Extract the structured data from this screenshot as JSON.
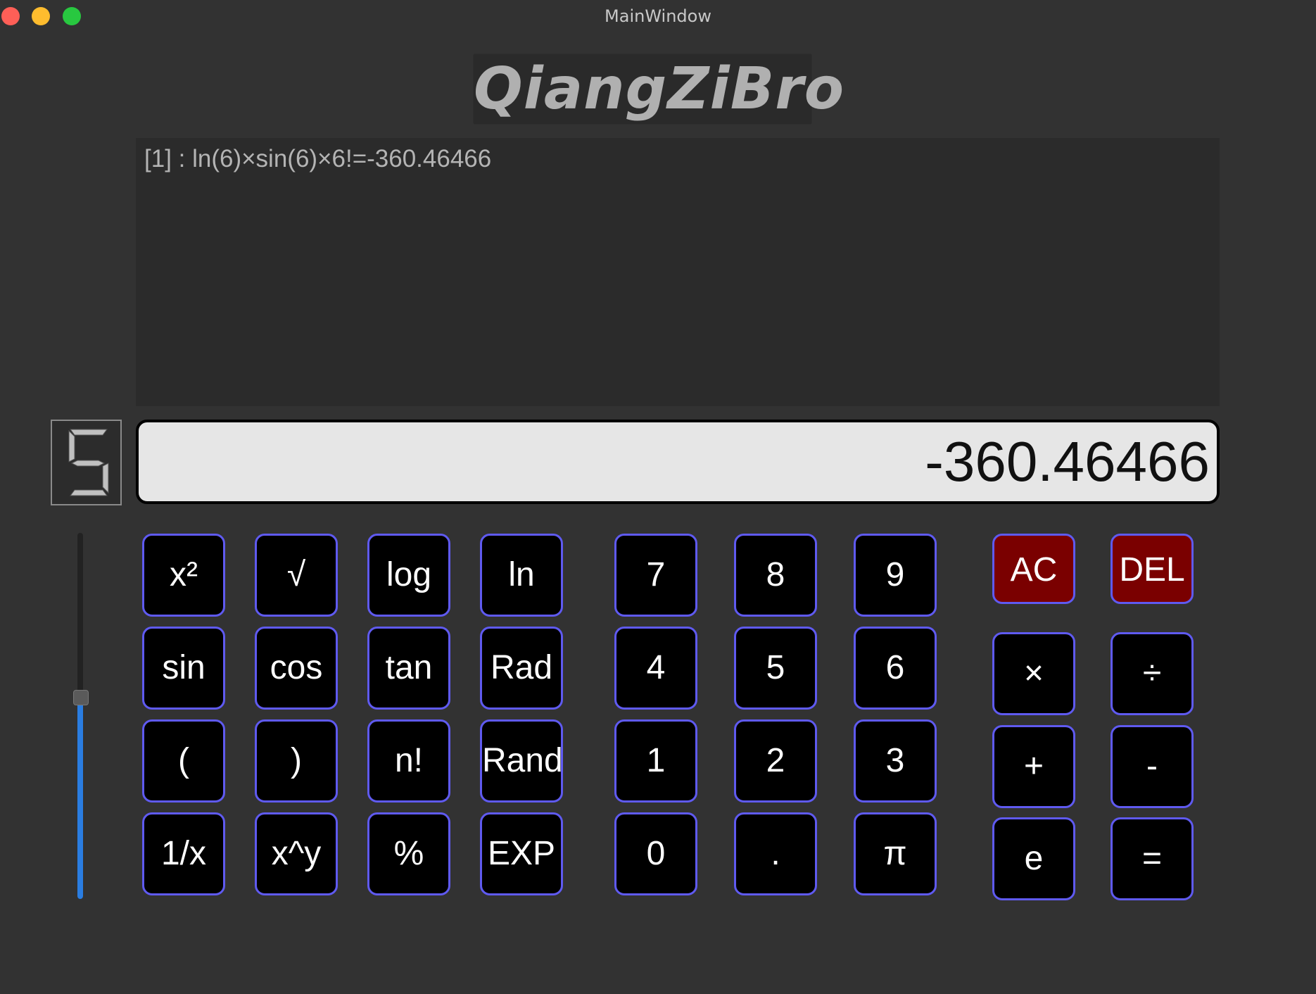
{
  "window": {
    "title": "MainWindow"
  },
  "brand": {
    "text": "QiangZiBro"
  },
  "history": {
    "lines": [
      "[1] : ln(6)×sin(6)×6!=-360.46466"
    ]
  },
  "lcd": {
    "value": "5"
  },
  "display": {
    "value": "-360.46466"
  },
  "slider": {
    "level_fraction": 0.55
  },
  "keys": {
    "function": [
      [
        "x²",
        "√",
        "log",
        "ln"
      ],
      [
        "sin",
        "cos",
        "tan",
        "Rad"
      ],
      [
        "(",
        ")",
        "n!",
        "Rand"
      ],
      [
        "1/x",
        "x^y",
        "%",
        "EXP"
      ]
    ],
    "digits": [
      [
        "7",
        "8",
        "9"
      ],
      [
        "4",
        "5",
        "6"
      ],
      [
        "1",
        "2",
        "3"
      ],
      [
        "0",
        ".",
        "π"
      ]
    ],
    "clear": [
      "AC",
      "DEL"
    ],
    "operators": [
      [
        "×",
        "÷"
      ],
      [
        "+",
        "-"
      ],
      [
        "e",
        "="
      ]
    ]
  },
  "colors": {
    "key_border": "#5f5af0",
    "clear_bg": "#7a0000",
    "slider_fill": "#2a7de1"
  }
}
